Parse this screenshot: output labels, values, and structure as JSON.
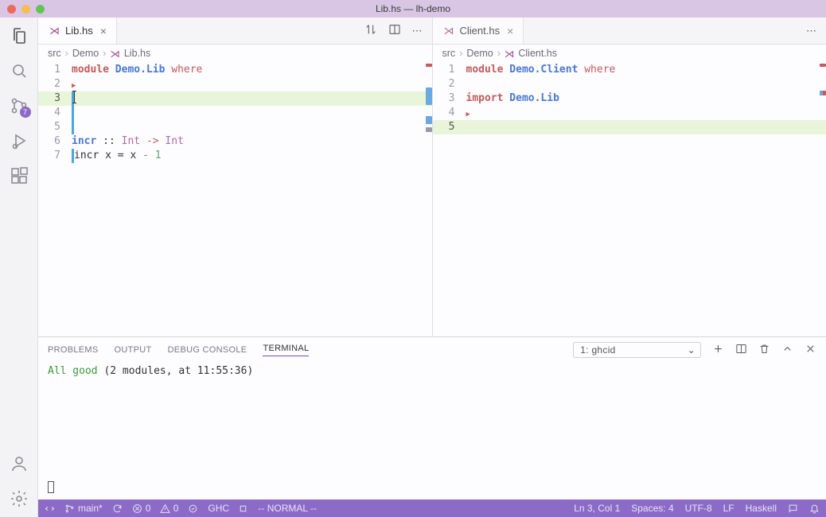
{
  "window": {
    "title": "Lib.hs — lh-demo"
  },
  "activity": {
    "badge": "7"
  },
  "left": {
    "tab": {
      "name": "Lib.hs"
    },
    "breadcrumb": {
      "p0": "src",
      "p1": "Demo",
      "p2": "Lib.hs"
    },
    "code": {
      "l1": {
        "n": "1",
        "kw": "module",
        "mod": "Demo.Lib",
        "wh": "where"
      },
      "l2": {
        "n": "2"
      },
      "l3": {
        "n": "3"
      },
      "l4": {
        "n": "4"
      },
      "l5": {
        "n": "5"
      },
      "l6": {
        "n": "6",
        "fn": "incr",
        "cc": " :: ",
        "t1": "Int",
        "arr": " -> ",
        "t2": "Int"
      },
      "l7": {
        "n": "7",
        "txt": "incr x = x ",
        "op": "-",
        "sp": " ",
        "num": "1"
      }
    }
  },
  "right": {
    "tab": {
      "name": "Client.hs"
    },
    "breadcrumb": {
      "p0": "src",
      "p1": "Demo",
      "p2": "Client.hs"
    },
    "code": {
      "l1": {
        "n": "1",
        "kw": "module",
        "mod": "Demo.Client",
        "wh": "where"
      },
      "l2": {
        "n": "2"
      },
      "l3": {
        "n": "3",
        "imp": "import",
        "mod": "Demo.Lib"
      },
      "l4": {
        "n": "4"
      },
      "l5": {
        "n": "5"
      }
    }
  },
  "panel": {
    "tabs": {
      "problems": "PROBLEMS",
      "output": "OUTPUT",
      "debug": "DEBUG CONSOLE",
      "terminal": "TERMINAL"
    },
    "select": "1: ghcid",
    "terminal": {
      "good": "All good",
      "rest": " (2 modules, at 11:55:36)"
    }
  },
  "status": {
    "branch": "main*",
    "errors": "0",
    "warnings": "0",
    "ghc": "GHC",
    "mode": "-- NORMAL --",
    "pos": "Ln 3, Col 1",
    "spaces": "Spaces: 4",
    "enc": "UTF-8",
    "eol": "LF",
    "lang": "Haskell"
  }
}
